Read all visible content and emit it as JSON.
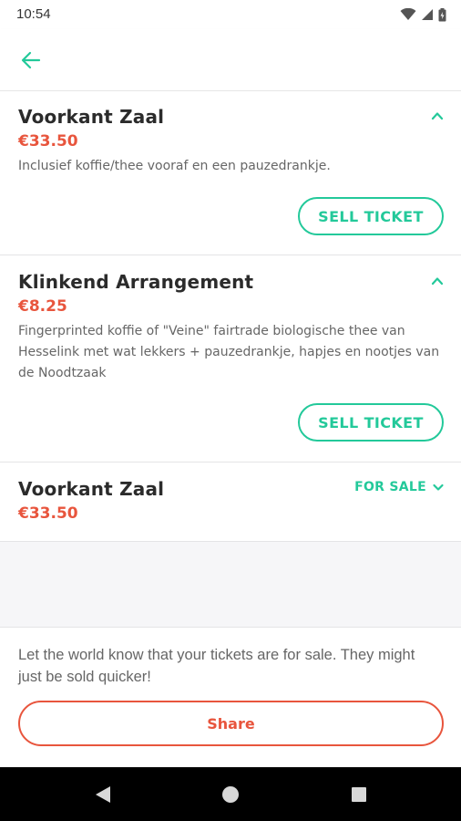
{
  "status_bar": {
    "time": "10:54"
  },
  "tickets": [
    {
      "title": "Voorkant Zaal",
      "price": "€33.50",
      "description": "Inclusief koffie/thee vooraf en een pauzedrankje.",
      "button": "SELL TICKET"
    },
    {
      "title": "Klinkend Arrangement",
      "price": "€8.25",
      "description": "Fingerprinted koffie of \"Veine\" fairtrade biologische thee van Hesselink met wat lekkers + pauzedrankje, hapjes en nootjes van de Noodtzaak",
      "button": "SELL TICKET"
    },
    {
      "title": "Voorkant Zaal",
      "price": "€33.50",
      "status": "FOR SALE"
    }
  ],
  "footer": {
    "message": "Let the world know that your tickets are for sale. They might just be sold quicker!",
    "share_label": "Share"
  },
  "colors": {
    "accent": "#23c99a",
    "price": "#e8553d"
  }
}
